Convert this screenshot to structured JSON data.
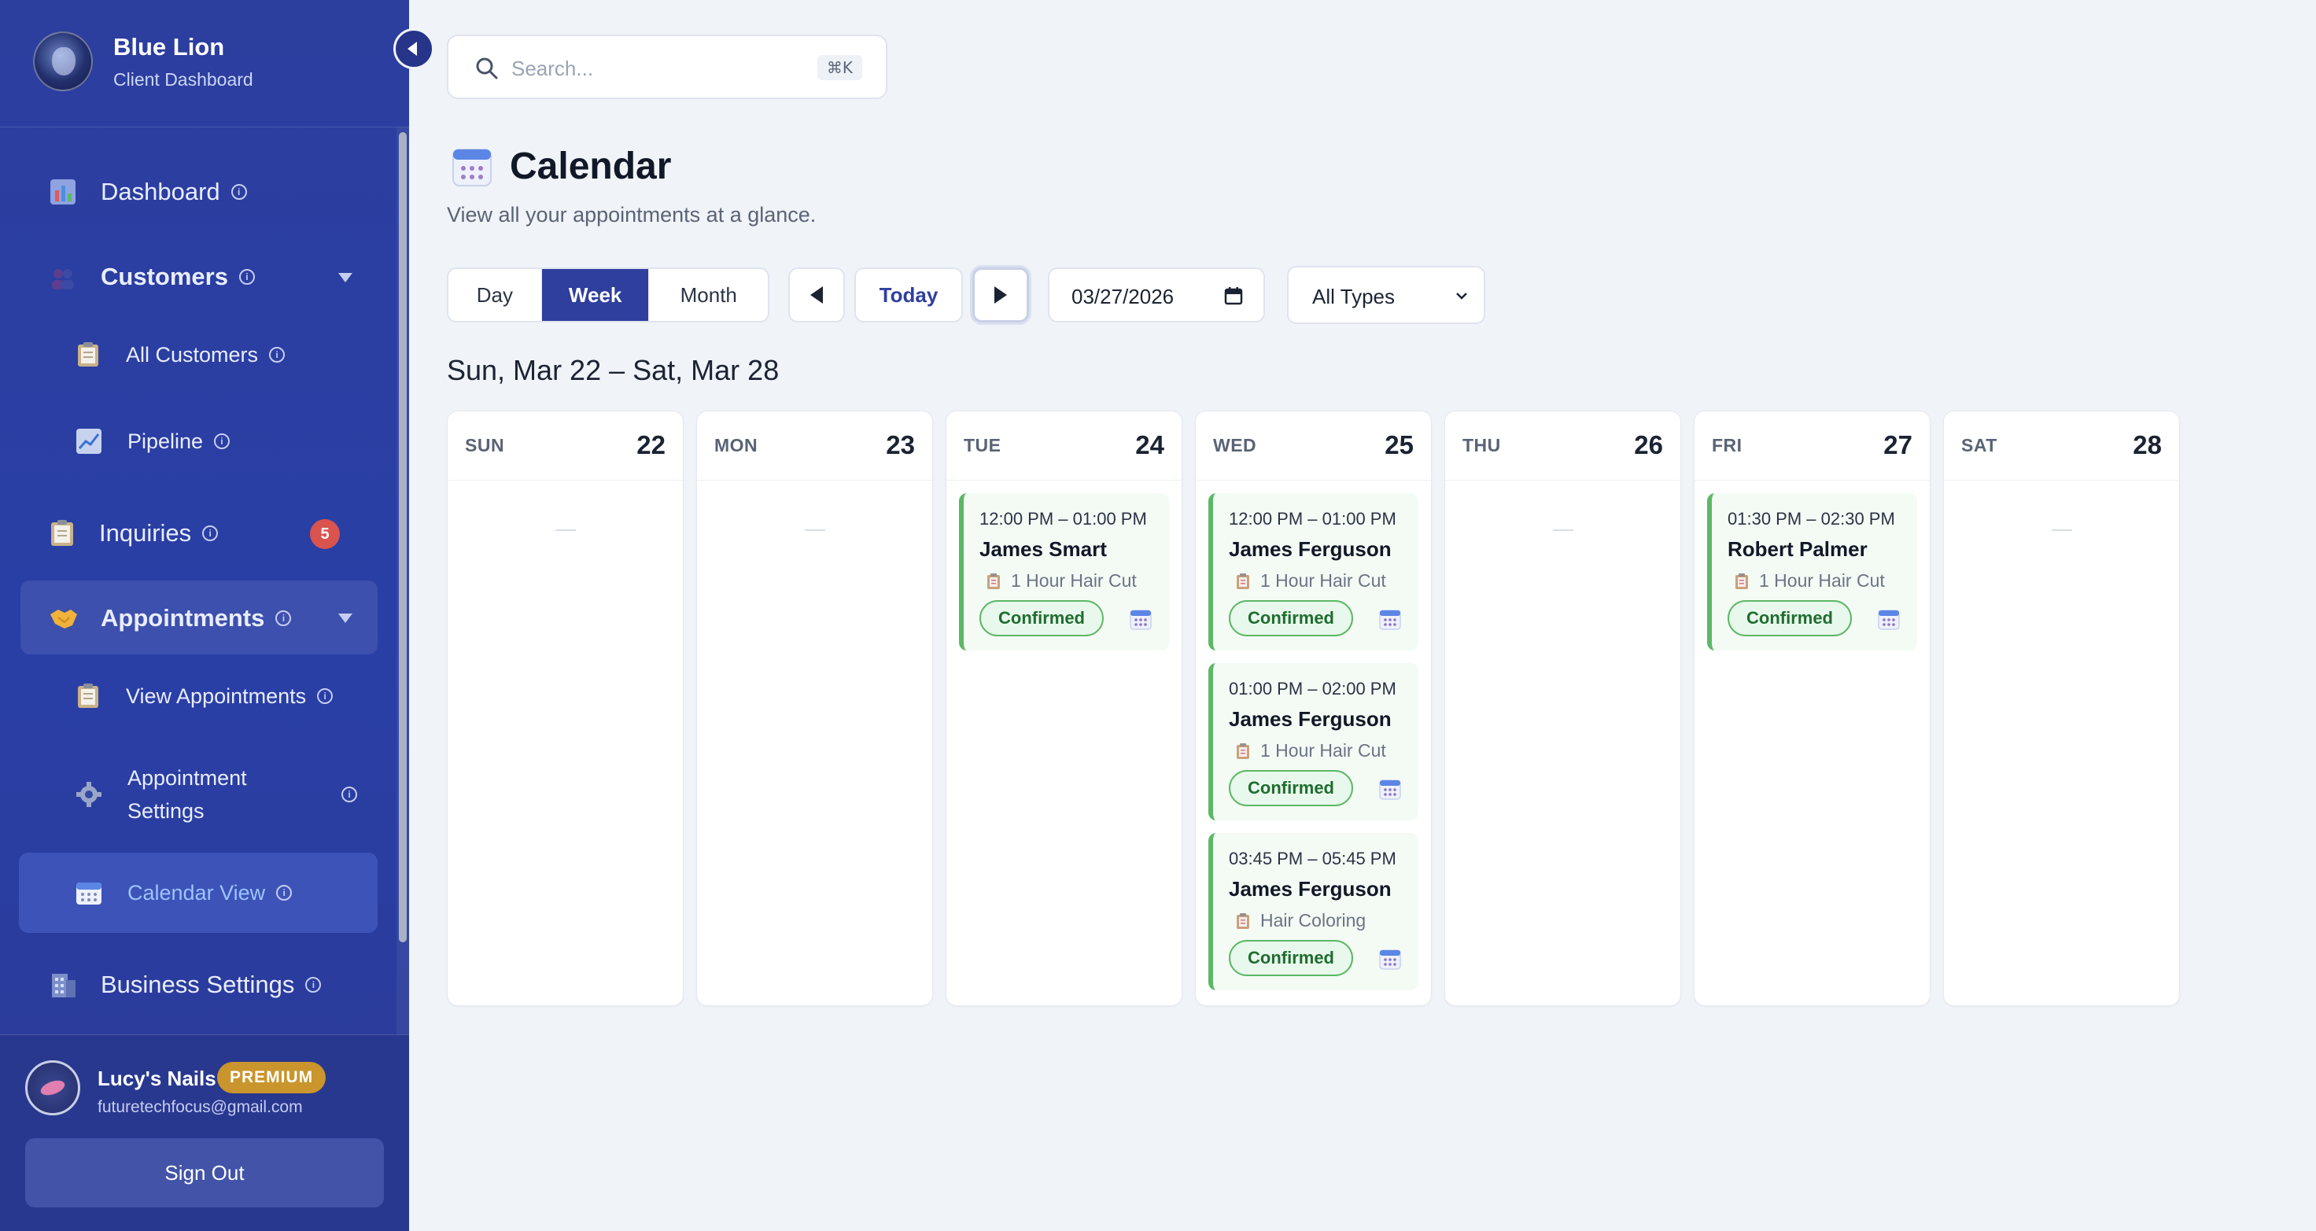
{
  "brand": {
    "name": "Blue Lion",
    "subtitle": "Client Dashboard"
  },
  "sidebar": {
    "items": [
      {
        "label": "Dashboard"
      },
      {
        "label": "Customers"
      },
      {
        "label": "All Customers"
      },
      {
        "label": "Pipeline"
      },
      {
        "label": "Inquiries",
        "badge": "5"
      },
      {
        "label": "Appointments"
      },
      {
        "label": "View Appointments"
      },
      {
        "label": "Appointment\nSettings"
      },
      {
        "label": "Calendar View"
      },
      {
        "label": "Business Settings"
      }
    ]
  },
  "user": {
    "name": "Lucy's Nails",
    "plan": "PREMIUM",
    "email": "futuretechfocus@gmail.com",
    "sign_out": "Sign Out"
  },
  "search": {
    "placeholder": "Search...",
    "shortcut": "⌘K"
  },
  "page": {
    "title": "Calendar",
    "subtitle": "View all your appointments at a glance."
  },
  "toolbar": {
    "views": [
      "Day",
      "Week",
      "Month"
    ],
    "active_view": "Week",
    "today": "Today",
    "date": "03/27/2026",
    "type_filter": "All Types"
  },
  "calendar": {
    "range": "Sun, Mar 22 – Sat, Mar 28",
    "days": [
      {
        "name": "SUN",
        "num": "22",
        "appointments": []
      },
      {
        "name": "MON",
        "num": "23",
        "appointments": []
      },
      {
        "name": "TUE",
        "num": "24",
        "appointments": [
          {
            "time": "12:00 PM – 01:00 PM",
            "client": "James Smart",
            "service": "1 Hour Hair Cut",
            "status": "Confirmed"
          }
        ]
      },
      {
        "name": "WED",
        "num": "25",
        "appointments": [
          {
            "time": "12:00 PM – 01:00 PM",
            "client": "James Ferguson",
            "service": "1 Hour Hair Cut",
            "status": "Confirmed"
          },
          {
            "time": "01:00 PM – 02:00 PM",
            "client": "James Ferguson",
            "service": "1 Hour Hair Cut",
            "status": "Confirmed"
          },
          {
            "time": "03:45 PM – 05:45 PM",
            "client": "James Ferguson",
            "service": "Hair Coloring",
            "status": "Confirmed"
          }
        ]
      },
      {
        "name": "THU",
        "num": "26",
        "appointments": []
      },
      {
        "name": "FRI",
        "num": "27",
        "appointments": [
          {
            "time": "01:30 PM – 02:30 PM",
            "client": "Robert Palmer",
            "service": "1 Hour Hair Cut",
            "status": "Confirmed"
          }
        ]
      },
      {
        "name": "SAT",
        "num": "28",
        "appointments": []
      }
    ]
  },
  "colors": {
    "sidebar": "#2c3e9e",
    "accent": "#2f3f9e",
    "confirmed": "#5cb865",
    "badge": "#d9534f",
    "premium": "#c9952c"
  }
}
